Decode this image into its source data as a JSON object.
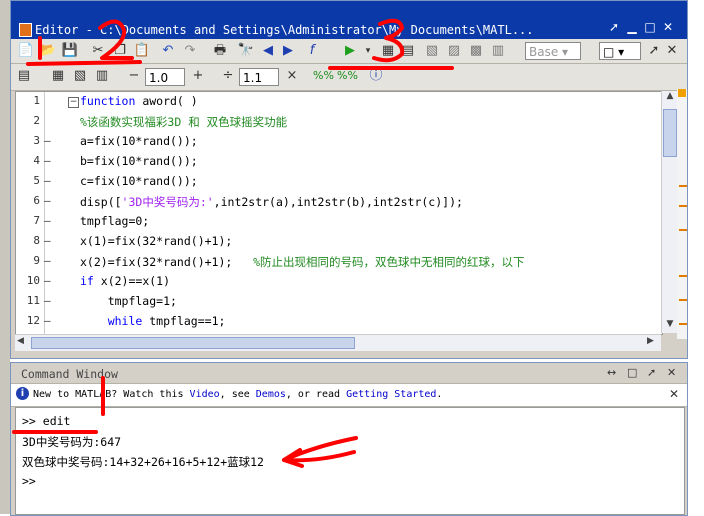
{
  "editor": {
    "title": "Editor - C:\\Documents and Settings\\Administrator\\My Documents\\MATL...",
    "toolbar": {
      "base_select": "Base"
    },
    "cell_toolbar": {
      "value1": "1.0",
      "value2": "1.1",
      "minus": "−",
      "plus": "+",
      "divide": "÷",
      "times": "×"
    },
    "lines": [
      {
        "num": "1",
        "dash": "",
        "text": "function aword( )"
      },
      {
        "num": "2",
        "dash": "",
        "text": "%该函数实现福彩3D 和 双色球摇奖功能"
      },
      {
        "num": "3",
        "dash": "–",
        "text": "a=fix(10*rand());"
      },
      {
        "num": "4",
        "dash": "–",
        "text": "b=fix(10*rand());"
      },
      {
        "num": "5",
        "dash": "–",
        "text": "c=fix(10*rand());"
      },
      {
        "num": "6",
        "dash": "–",
        "text": "disp(['3D中奖号码为:',int2str(a),int2str(b),int2str(c)]);"
      },
      {
        "num": "7",
        "dash": "–",
        "text": "tmpflag=0;"
      },
      {
        "num": "8",
        "dash": "–",
        "text": "x(1)=fix(32*rand()+1);"
      },
      {
        "num": "9",
        "dash": "–",
        "text": "x(2)=fix(32*rand()+1);   %防止出现相同的号码，双色球中无相同的红球，以下"
      },
      {
        "num": "10",
        "dash": "–",
        "text": "if x(2)==x(1)"
      },
      {
        "num": "11",
        "dash": "–",
        "text": "    tmpflag=1;"
      },
      {
        "num": "12",
        "dash": "–",
        "text": "    while tmpflag==1;"
      }
    ]
  },
  "command_window": {
    "title": "Command Window",
    "info": {
      "prefix": "New to MATLAB? Watch this ",
      "video": "Video",
      "mid": ", see ",
      "demos": "Demos",
      "mid2": ", or read ",
      "getting_started": "Getting Started",
      "suffix": "."
    },
    "lines": [
      ">> edit",
      "3D中奖号码为:647",
      "双色球中奖号码:14+32+26+16+5+12+蓝球12",
      ">>"
    ]
  },
  "annotations": {
    "label1": "1",
    "label2": "2",
    "label3": "3"
  },
  "colors": {
    "title_bar": "#0b3aa8",
    "annotation": "#ff0000",
    "keyword": "#0000ff",
    "comment": "#228b22",
    "string": "#a020f0"
  }
}
